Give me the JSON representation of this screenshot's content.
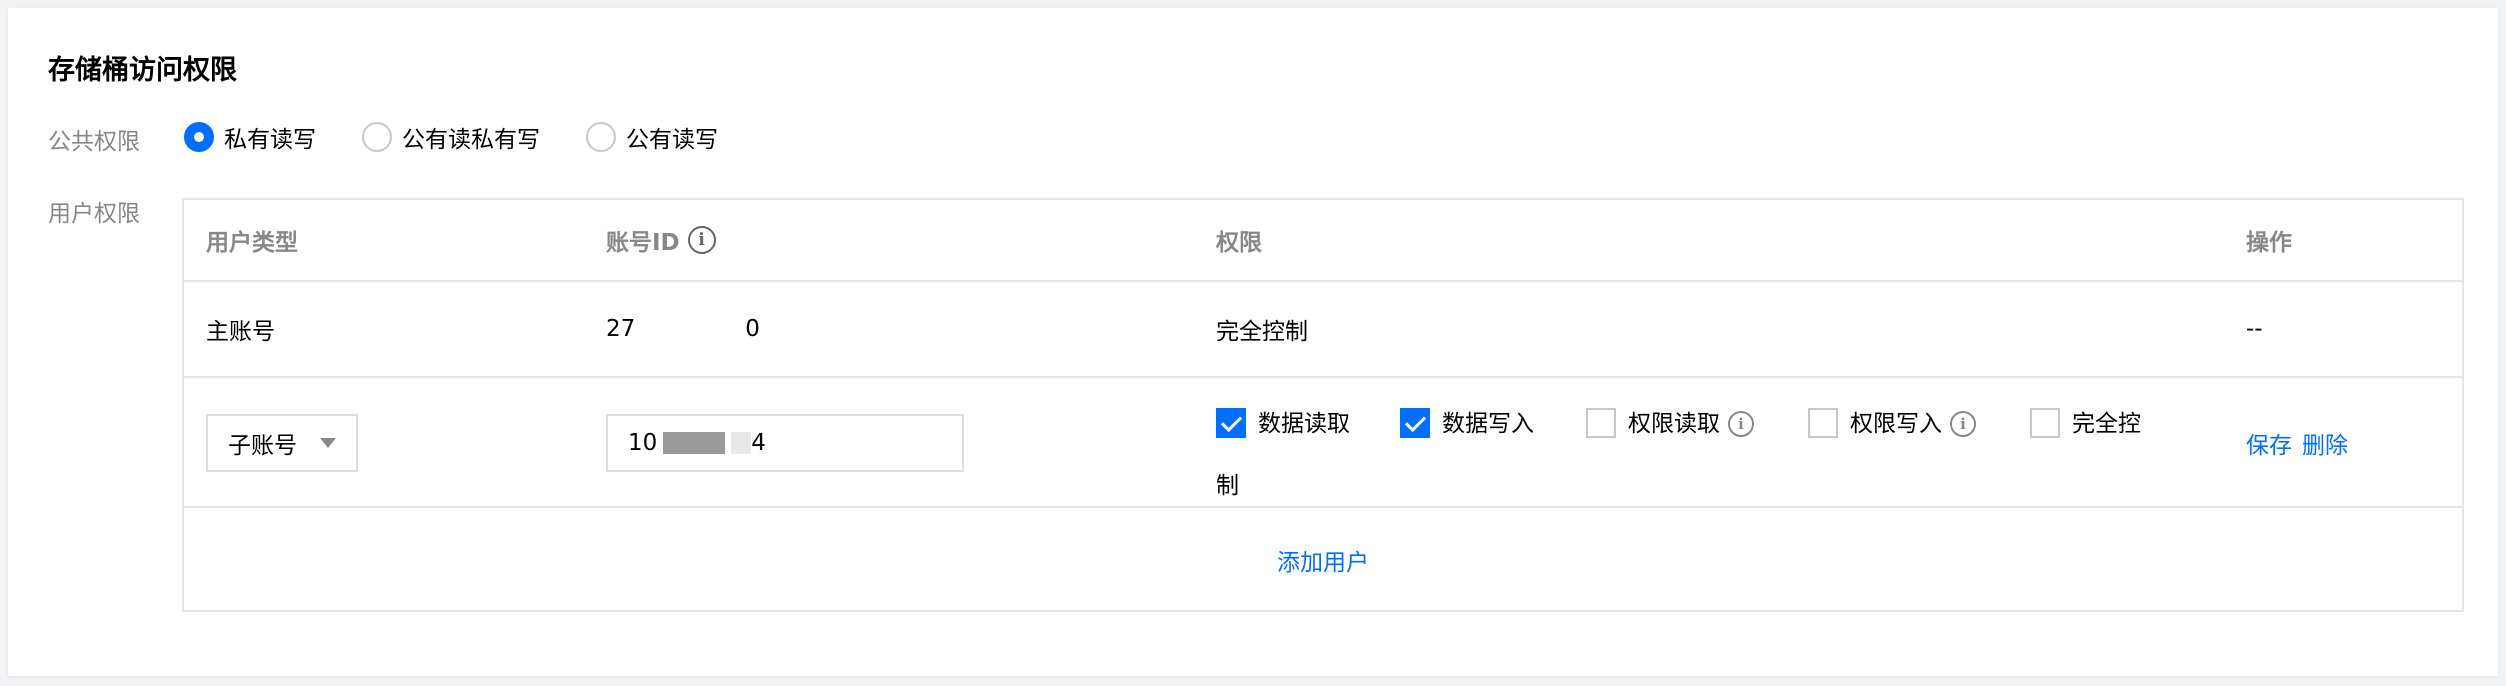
{
  "title": "存储桶访问权限",
  "public_permission": {
    "label": "公共权限",
    "options": [
      {
        "label": "私有读写",
        "checked": true
      },
      {
        "label": "公有读私有写",
        "checked": false
      },
      {
        "label": "公有读写",
        "checked": false
      }
    ]
  },
  "user_permission": {
    "label": "用户权限",
    "headers": {
      "user_type": "用户类型",
      "account_id": "账号ID",
      "permission": "权限",
      "actions": "操作"
    },
    "main_row": {
      "user_type": "主账号",
      "account_id_prefix": "27",
      "account_id_suffix": "0",
      "permission": "完全控制",
      "actions": "--"
    },
    "sub_row": {
      "user_type_selected": "子账号",
      "account_id_prefix": "10",
      "account_id_suffix": "4",
      "checkboxes": [
        {
          "label": "数据读取",
          "checked": true
        },
        {
          "label": "数据写入",
          "checked": true
        },
        {
          "label": "权限读取",
          "checked": false,
          "info": true
        },
        {
          "label": "权限写入",
          "checked": false,
          "info": true
        },
        {
          "label": "完全控",
          "checked": false
        }
      ],
      "wrapped_text": "制",
      "save": "保存",
      "delete": "删除"
    },
    "add_user": "添加用户"
  },
  "colors": {
    "accent": "#006eff",
    "muted_text": "#888888",
    "border": "#e5e5e5"
  },
  "icons": {
    "info": "i"
  }
}
